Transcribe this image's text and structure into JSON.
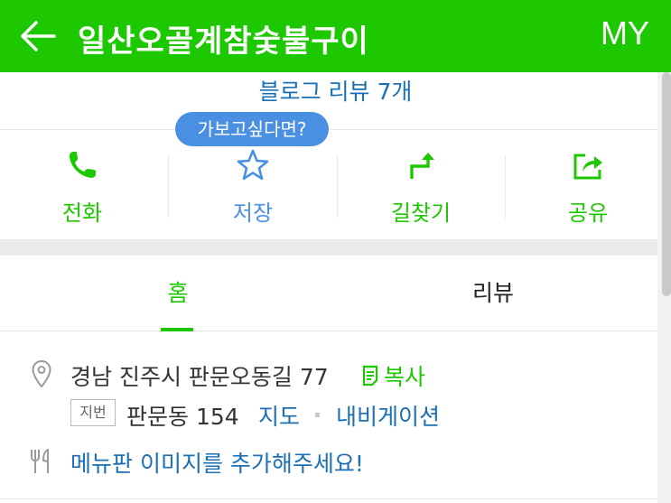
{
  "header": {
    "title": "일산오골계참숯불구이",
    "my_label": "MY",
    "back_icon": "back-arrow-icon"
  },
  "blog_review": "블로그 리뷰 7개",
  "tooltip": "가보고싶다면?",
  "actions": [
    {
      "label": "전화",
      "icon": "phone-icon",
      "color": "#1ec800"
    },
    {
      "label": "저장",
      "icon": "star-icon",
      "color": "#4a90e2"
    },
    {
      "label": "길찾기",
      "icon": "directions-icon",
      "color": "#1ec800"
    },
    {
      "label": "공유",
      "icon": "share-icon",
      "color": "#1ec800"
    }
  ],
  "tabs": [
    {
      "label": "홈",
      "selected": true
    },
    {
      "label": "리뷰",
      "selected": false
    }
  ],
  "info": {
    "address": "경남 진주시 판문오동길 77",
    "copy_label": "복사",
    "jibun_badge": "지번",
    "jibun_address": "판문동 154",
    "map_link": "지도",
    "nav_link": "내비게이션",
    "menu_prompt": "메뉴판 이미지를 추가해주세요!"
  },
  "colors": {
    "brand": "#1ec800",
    "link": "#1a6fb5",
    "tooltip": "#4a90e2"
  }
}
